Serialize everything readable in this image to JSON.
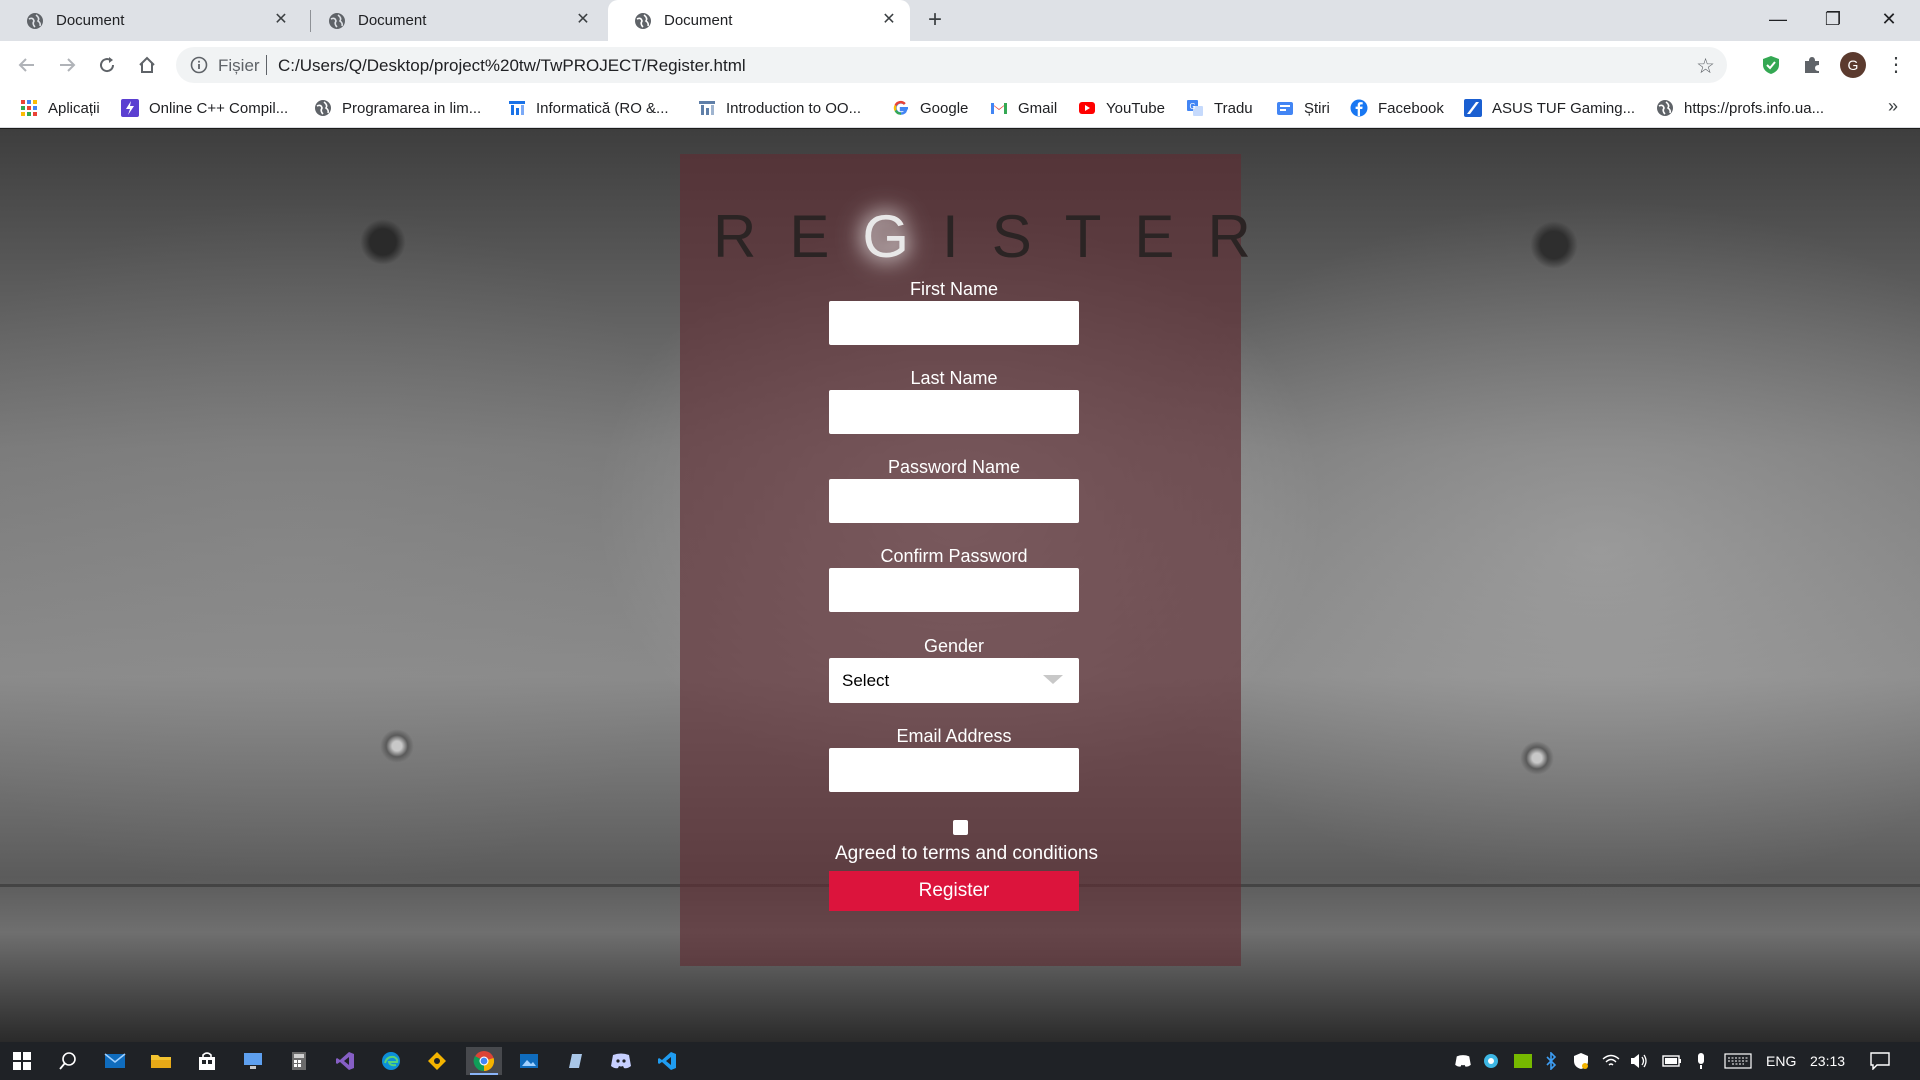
{
  "browser": {
    "tabs": [
      {
        "title": "Document"
      },
      {
        "title": "Document"
      },
      {
        "title": "Document"
      }
    ],
    "address": {
      "scheme_label": "Fișier",
      "url": "C:/Users/Q/Desktop/project%20tw/TwPROJECT/Register.html"
    },
    "profile_initial": "G",
    "bookmarks": [
      {
        "label": "Aplicații",
        "icon": "apps-grid-icon"
      },
      {
        "label": "Online C++ Compil...",
        "icon": "bolt-icon"
      },
      {
        "label": "Programarea in lim...",
        "icon": "globe-icon"
      },
      {
        "label": "Informatică (RO &...",
        "icon": "chart-icon"
      },
      {
        "label": "Introduction to OO...",
        "icon": "chart-icon"
      },
      {
        "label": "Google",
        "icon": "google-icon"
      },
      {
        "label": "Gmail",
        "icon": "gmail-icon"
      },
      {
        "label": "YouTube",
        "icon": "youtube-icon"
      },
      {
        "label": "Tradu",
        "icon": "translate-icon"
      },
      {
        "label": "Știri",
        "icon": "news-icon"
      },
      {
        "label": "Facebook",
        "icon": "facebook-icon"
      },
      {
        "label": "ASUS TUF Gaming...",
        "icon": "asus-icon"
      },
      {
        "label": "https://profs.info.ua...",
        "icon": "globe-icon"
      }
    ],
    "bookmarks_overflow": "»"
  },
  "page": {
    "title": "REGISTER",
    "fields": {
      "first_name": {
        "label": "First Name",
        "value": ""
      },
      "last_name": {
        "label": "Last Name",
        "value": ""
      },
      "password": {
        "label": "Password Name",
        "value": ""
      },
      "confirm_password": {
        "label": "Confirm Password",
        "value": ""
      },
      "gender": {
        "label": "Gender",
        "selected": "Select"
      },
      "email": {
        "label": "Email Address",
        "value": ""
      }
    },
    "terms_label": "Agreed to terms and conditions",
    "terms_checked": false,
    "register_label": "Register",
    "colors": {
      "panel": "#5f2c32",
      "button": "#dc143c"
    }
  },
  "taskbar": {
    "language": "ENG",
    "time": "23:13"
  }
}
